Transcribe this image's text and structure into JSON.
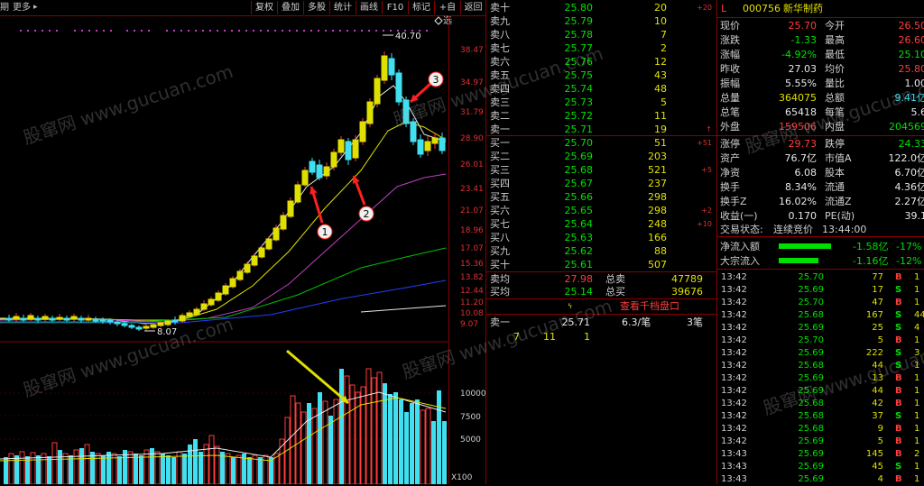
{
  "toolbar": {
    "left_label": "期",
    "more_label": "更多",
    "more_arrow": "▸",
    "buttons": [
      "复权",
      "叠加",
      "多股",
      "统计",
      "画线",
      "F10",
      "标记",
      "+自选",
      "返回"
    ]
  },
  "price_axis": [
    "38.47",
    "34.97",
    "31.79",
    "28.90",
    "26.01",
    "23.41",
    "21.07",
    "18.96",
    "17.07",
    "15.36",
    "13.82",
    "12.44",
    "11.20",
    "10.08",
    "9.07"
  ],
  "volume_axis": [
    "10000",
    "7500",
    "5000"
  ],
  "volume_unit": "X100",
  "kline_labels": {
    "high": "40.70",
    "low": "8.07"
  },
  "annotations": [
    "1",
    "2",
    "3"
  ],
  "watermark": "股窜网 www.gucuan.com",
  "orderbook": {
    "asks": [
      {
        "label": "卖十",
        "price": "25.80",
        "vol": "20",
        "chg": "+20"
      },
      {
        "label": "卖九",
        "price": "25.79",
        "vol": "10",
        "chg": ""
      },
      {
        "label": "卖八",
        "price": "25.78",
        "vol": "7",
        "chg": ""
      },
      {
        "label": "卖七",
        "price": "25.77",
        "vol": "2",
        "chg": ""
      },
      {
        "label": "卖六",
        "price": "25.76",
        "vol": "12",
        "chg": ""
      },
      {
        "label": "卖五",
        "price": "25.75",
        "vol": "43",
        "chg": ""
      },
      {
        "label": "卖四",
        "price": "25.74",
        "vol": "48",
        "chg": ""
      },
      {
        "label": "卖三",
        "price": "25.73",
        "vol": "5",
        "chg": ""
      },
      {
        "label": "卖二",
        "price": "25.72",
        "vol": "11",
        "chg": ""
      },
      {
        "label": "卖一",
        "price": "25.71",
        "vol": "19",
        "chg": "↑"
      }
    ],
    "bids": [
      {
        "label": "买一",
        "price": "25.70",
        "vol": "51",
        "chg": "+51"
      },
      {
        "label": "买二",
        "price": "25.69",
        "vol": "203",
        "chg": ""
      },
      {
        "label": "买三",
        "price": "25.68",
        "vol": "521",
        "chg": "+5"
      },
      {
        "label": "买四",
        "price": "25.67",
        "vol": "237",
        "chg": ""
      },
      {
        "label": "买五",
        "price": "25.66",
        "vol": "298",
        "chg": ""
      },
      {
        "label": "买六",
        "price": "25.65",
        "vol": "298",
        "chg": "+2"
      },
      {
        "label": "买七",
        "price": "25.64",
        "vol": "248",
        "chg": "+10"
      },
      {
        "label": "买八",
        "price": "25.63",
        "vol": "166",
        "chg": ""
      },
      {
        "label": "买九",
        "price": "25.62",
        "vol": "88",
        "chg": ""
      },
      {
        "label": "买十",
        "price": "25.61",
        "vol": "507",
        "chg": ""
      }
    ],
    "avg_ask_label": "卖均",
    "avg_ask_price": "27.98",
    "total_ask_label": "总卖",
    "total_ask": "47789",
    "avg_bid_label": "买均",
    "avg_bid_price": "25.14",
    "total_bid_label": "总买",
    "total_bid": "39676",
    "depth_link": "查看千档盘口",
    "queue_label": "卖一",
    "queue_price": "25.71",
    "queue_info": "6.3/笔",
    "queue_count": "3笔",
    "queue_items": [
      "7",
      "11",
      "1"
    ]
  },
  "stock": {
    "code": "000756",
    "name": "新华制药",
    "flag": "L"
  },
  "info": [
    {
      "k1": "现价",
      "v1": "25.70",
      "c1": "red",
      "k2": "今开",
      "v2": "26.50",
      "c2": "red"
    },
    {
      "k1": "涨跌",
      "v1": "-1.33",
      "c1": "grn",
      "k2": "最高",
      "v2": "26.60",
      "c2": "red"
    },
    {
      "k1": "涨幅",
      "v1": "-4.92%",
      "c1": "grn",
      "k2": "最低",
      "v2": "25.10",
      "c2": "grn"
    },
    {
      "k1": "昨收",
      "v1": "27.03",
      "c1": "wht",
      "k2": "均价",
      "v2": "25.80",
      "c2": "red"
    },
    {
      "k1": "振幅",
      "v1": "5.55%",
      "c1": "wht",
      "k2": "量比",
      "v2": "1.00",
      "c2": "wht"
    },
    {
      "k1": "总量",
      "v1": "364075",
      "c1": "yel",
      "k2": "总额",
      "v2": "9.41亿",
      "c2": "cyan"
    },
    {
      "k1": "总笔",
      "v1": "65418",
      "c1": "wht",
      "k2": "每笔",
      "v2": "5.6",
      "c2": "wht"
    },
    {
      "k1": "外盘",
      "v1": "159506",
      "c1": "red",
      "k2": "内盘",
      "v2": "204569",
      "c2": "grn"
    },
    {
      "k1": "涨停",
      "v1": "29.73",
      "c1": "red",
      "k2": "跌停",
      "v2": "24.33",
      "c2": "grn"
    },
    {
      "k1": "资产",
      "v1": "76.7亿",
      "c1": "wht",
      "k2": "市值A",
      "v2": "122.0亿",
      "c2": "wht"
    },
    {
      "k1": "净资",
      "v1": "6.08",
      "c1": "wht",
      "k2": "股本",
      "v2": "6.70亿",
      "c2": "wht"
    },
    {
      "k1": "换手",
      "v1": "8.34%",
      "c1": "wht",
      "k2": "流通",
      "v2": "4.36亿",
      "c2": "wht"
    },
    {
      "k1": "换手Z",
      "v1": "16.02%",
      "c1": "wht",
      "k2": "流通Z",
      "v2": "2.27亿",
      "c2": "wht"
    },
    {
      "k1": "收益(一)",
      "v1": "0.170",
      "c1": "wht",
      "k2": "PE(动)",
      "v2": "39.1",
      "c2": "wht"
    }
  ],
  "trade_status": {
    "label": "交易状态:",
    "status": "连续竞价",
    "time": "13:44:00"
  },
  "flows": [
    {
      "label": "净流入额",
      "value": "-1.58亿",
      "pct": "-17%"
    },
    {
      "label": "大宗流入",
      "value": "-1.16亿",
      "pct": "-12%"
    }
  ],
  "ticks": [
    {
      "t": "13:42",
      "p": "25.70",
      "v": "77",
      "s": "B",
      "e": "1"
    },
    {
      "t": "13:42",
      "p": "25.69",
      "v": "17",
      "s": "S",
      "e": "1"
    },
    {
      "t": "13:42",
      "p": "25.70",
      "v": "47",
      "s": "B",
      "e": "1"
    },
    {
      "t": "13:42",
      "p": "25.68",
      "v": "167",
      "s": "S",
      "e": "44"
    },
    {
      "t": "13:42",
      "p": "25.69",
      "v": "25",
      "s": "S",
      "e": "4"
    },
    {
      "t": "13:42",
      "p": "25.70",
      "v": "5",
      "s": "B",
      "e": "1"
    },
    {
      "t": "13:42",
      "p": "25.69",
      "v": "222",
      "s": "S",
      "e": "3"
    },
    {
      "t": "13:42",
      "p": "25.68",
      "v": "44",
      "s": "S",
      "e": "1"
    },
    {
      "t": "13:42",
      "p": "25.69",
      "v": "13",
      "s": "B",
      "e": "1"
    },
    {
      "t": "13:42",
      "p": "25.69",
      "v": "44",
      "s": "B",
      "e": "1"
    },
    {
      "t": "13:42",
      "p": "25.68",
      "v": "42",
      "s": "B",
      "e": "1"
    },
    {
      "t": "13:42",
      "p": "25.68",
      "v": "37",
      "s": "S",
      "e": "1"
    },
    {
      "t": "13:42",
      "p": "25.68",
      "v": "9",
      "s": "B",
      "e": "1"
    },
    {
      "t": "13:42",
      "p": "25.69",
      "v": "5",
      "s": "B",
      "e": "1"
    },
    {
      "t": "13:43",
      "p": "25.69",
      "v": "145",
      "s": "B",
      "e": "2"
    },
    {
      "t": "13:43",
      "p": "25.69",
      "v": "45",
      "s": "S",
      "e": "1"
    },
    {
      "t": "13:43",
      "p": "25.69",
      "v": "4",
      "s": "B",
      "e": "1"
    }
  ],
  "colors": {
    "up": "#ff3c3c",
    "down": "#40e0f0",
    "frame": "#8a0000",
    "yellow": "#e0e000",
    "green": "#00e000"
  }
}
